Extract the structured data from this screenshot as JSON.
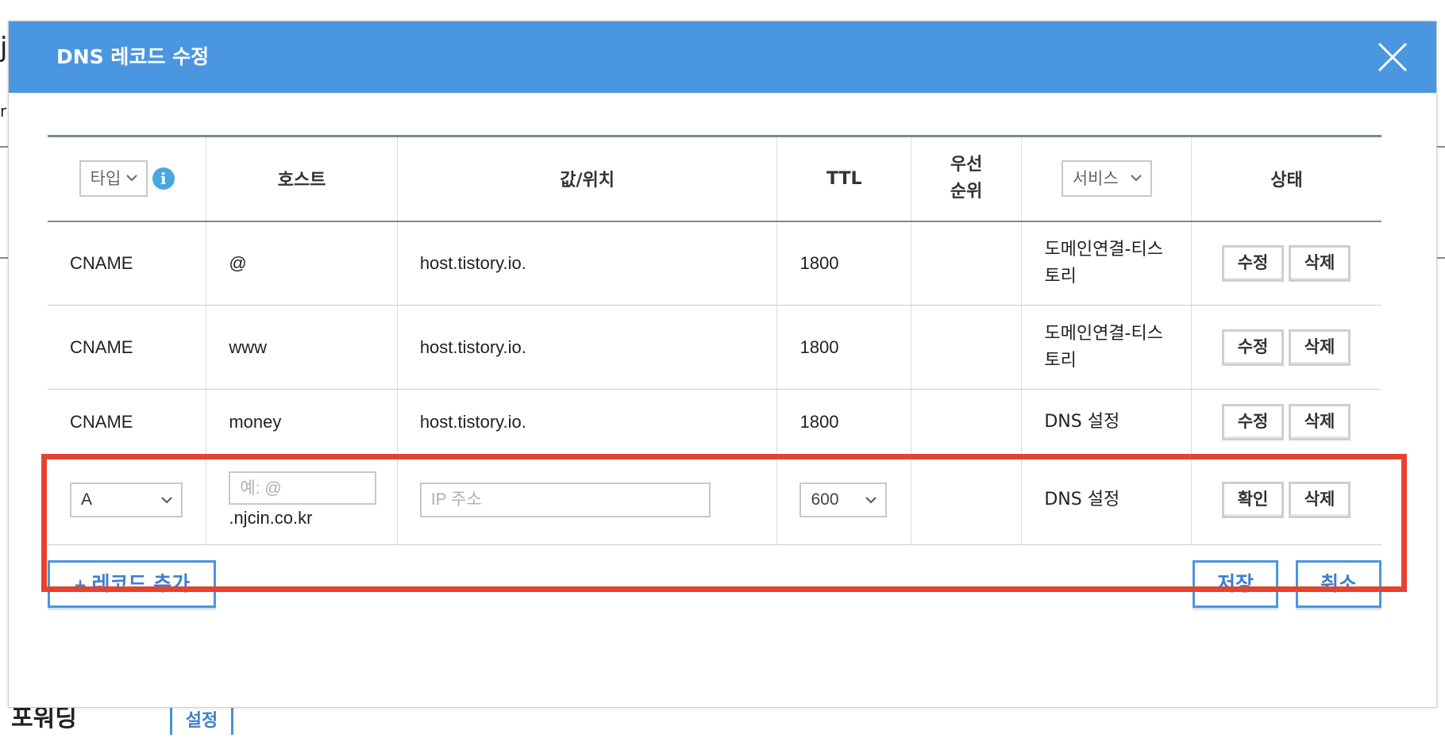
{
  "modal": {
    "title": "DNS 레코드 수정"
  },
  "table": {
    "headers": {
      "type_select": "타입",
      "host": "호스트",
      "value": "값/위치",
      "ttl": "TTL",
      "priority_line1": "우선",
      "priority_line2": "순위",
      "service_select": "서비스",
      "status": "상태"
    },
    "rows": [
      {
        "type": "CNAME",
        "host": "@",
        "value": "host.tistory.io.",
        "ttl": "1800",
        "priority": "",
        "service_line1": "도메인연결-티스",
        "service_line2": "토리",
        "edit": "수정",
        "delete": "삭제"
      },
      {
        "type": "CNAME",
        "host": "www",
        "value": "host.tistory.io.",
        "ttl": "1800",
        "priority": "",
        "service_line1": "도메인연결-티스",
        "service_line2": "토리",
        "edit": "수정",
        "delete": "삭제"
      },
      {
        "type": "CNAME",
        "host": "money",
        "value": "host.tistory.io.",
        "ttl": "1800",
        "priority": "",
        "service_line1": "DNS 설정",
        "service_line2": "",
        "edit": "수정",
        "delete": "삭제"
      }
    ],
    "new_row": {
      "type_value": "A",
      "host_placeholder": "예: @",
      "host_suffix": ".njcin.co.kr",
      "ip_placeholder": "IP 주소",
      "ttl_value": "600",
      "service": "DNS 설정",
      "confirm": "확인",
      "delete": "삭제"
    }
  },
  "footer": {
    "add_record": "레코드 추가",
    "add_plus": "+",
    "save": "저장",
    "cancel": "취소"
  },
  "background": {
    "forwarding_label": "포워딩",
    "setting_button": "설정"
  },
  "colors": {
    "header_blue": "#4b96e0",
    "highlight_red": "#e5432f",
    "info_blue": "#49a7e0"
  }
}
